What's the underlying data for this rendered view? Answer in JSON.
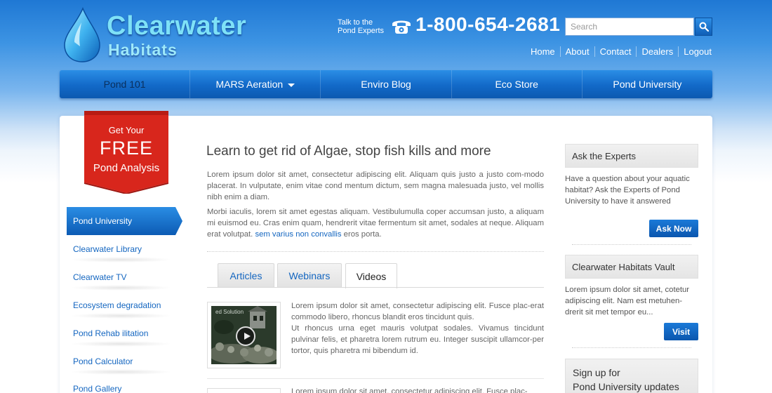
{
  "header": {
    "logo_line1": "Clearwater",
    "logo_line2": "Habitats",
    "talk_line1": "Talk to the",
    "talk_line2": "Pond Experts",
    "phone": "1-800-654-2681",
    "phone_icon": "telephone-icon",
    "search_placeholder": "Search",
    "search_icon": "search-icon",
    "links": [
      "Home",
      "About",
      "Contact",
      "Dealers",
      "Logout"
    ]
  },
  "nav": {
    "items": [
      "Pond 101",
      "MARS Aeration",
      "Enviro Blog",
      "Eco Store",
      "Pond University"
    ]
  },
  "promo": {
    "line1": "Get Your",
    "line2": "FREE",
    "line3": "Pond Analysis"
  },
  "sidebar": {
    "active": "Pond University",
    "items": [
      "Clearwater Library",
      "Clearwater TV",
      "Ecosystem degradation",
      "Pond Rehab ilitation",
      "Pond Calculator",
      "Pond Gallery"
    ]
  },
  "main": {
    "headline": "Learn to get rid of Algae, stop fish kills and more",
    "para1": "Lorem ipsum dolor sit amet, consectetur adipiscing elit. Aliquam quis justo a justo com-modo placerat. In vulputate, enim vitae cond mentum dictum, sem magna malesuada justo, vel mollis nibh enim a diam.",
    "para2": "Morbi iaculis, lorem sit amet egestas aliquam. Vestibulumulla coper accumsan justo, a aliquam mi euismod eu. Cras enim quam, hendrerit vitae fermentum sit amet, sodales at neque. Aliquam erat volutpat.",
    "para2_link": "sem varius non convallis",
    "para2_tail": "eros porta.",
    "tabs": [
      "Articles",
      "Webinars",
      "Videos"
    ],
    "active_tab": "Videos",
    "items": [
      {
        "thumb_label": "ed Solution",
        "text1": "Lorem ipsum dolor sit amet, consectetur adipiscing elit. Fusce plac-erat commodo libero, rhoncus blandit eros tincidunt quis.",
        "text2": "Ut rhoncus urna eget mauris volutpat sodales. Vivamus tincidunt pulvinar felis, et pharetra lorem rutrum eu. Integer suscipit ullamcor-per tortor, quis pharetra mi bibendum id."
      },
      {
        "text1": "Lorem ipsum dolor sit amet, consectetur adipiscing elit. Fusce plac-"
      }
    ]
  },
  "right": {
    "experts_title": "Ask the Experts",
    "experts_text": "Have a question about your aquatic habitat? Ask the Experts of Pond University to have it answered",
    "experts_button": "Ask Now",
    "vault_title": "Clearwater Habitats Vault",
    "vault_text": "Lorem ipsum dolor sit amet, cotetur adipiscing elit. Nam est metuhen-drerit sit met tempor eu...",
    "vault_button": "Visit",
    "signup_line1": "Sign up for",
    "signup_line2": "Pond University updates"
  },
  "colors": {
    "brand_blue": "#1269c8",
    "link_blue": "#1466c0",
    "ribbon_red": "#d8261c"
  }
}
